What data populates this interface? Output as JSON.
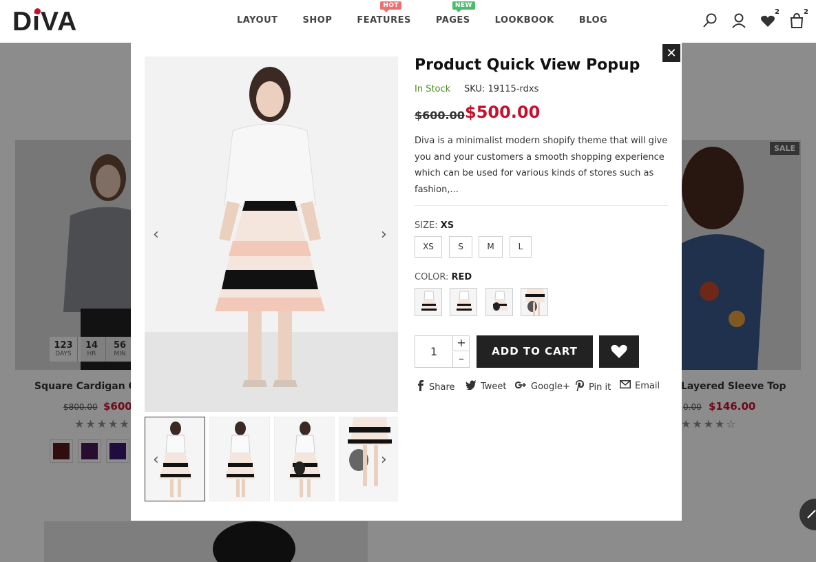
{
  "header": {
    "logo": "DiVA",
    "nav": [
      {
        "label": "LAYOUT",
        "badge": ""
      },
      {
        "label": "SHOP",
        "badge": ""
      },
      {
        "label": "FEATURES",
        "badge": "HOT"
      },
      {
        "label": "PAGES",
        "badge": "NEW"
      },
      {
        "label": "LOOKBOOK",
        "badge": ""
      },
      {
        "label": "BLOG",
        "badge": ""
      }
    ],
    "wishlist_count": "2",
    "cart_count": "2"
  },
  "background": {
    "left_product": {
      "title": "Square Cardigan Co",
      "old_price": "$800.00",
      "new_price": "$600.",
      "stars": "★★★★★",
      "countdown": [
        {
          "num": "123",
          "label": "DAYS"
        },
        {
          "num": "14",
          "label": "HR"
        },
        {
          "num": "56",
          "label": "MIN"
        }
      ]
    },
    "right_product": {
      "title": "Layered Sleeve Top",
      "old_price": "0.00",
      "new_price": "$146.00",
      "stars": "★★★★☆",
      "sale": "SALE"
    }
  },
  "product": {
    "title": "Product Quick View Popup",
    "stock": "In Stock",
    "sku_label": "SKU:",
    "sku": "19115-rdxs",
    "old_price": "$600.00",
    "new_price": "$500.00",
    "description": "Diva is a minimalist modern shopify theme that will give you and your customers a smooth shopping experience which can be used for various kinds of stores such as fashion,...",
    "size_label": "SIZE:",
    "size_selected": "XS",
    "sizes": [
      "XS",
      "S",
      "M",
      "L"
    ],
    "color_label": "COLOR:",
    "color_selected": "RED",
    "quantity": "1",
    "add_to_cart": "ADD TO CART",
    "share": [
      {
        "icon": "facebook-icon",
        "label": "Share"
      },
      {
        "icon": "twitter-icon",
        "label": "Tweet"
      },
      {
        "icon": "google-plus-icon",
        "label": "Google+"
      },
      {
        "icon": "pinterest-icon",
        "label": "Pin it"
      },
      {
        "icon": "email-icon",
        "label": "Email"
      }
    ]
  },
  "colors": {
    "accent_red": "#c8102e",
    "in_stock_green": "#4a8b1e",
    "button_dark": "#222222"
  }
}
